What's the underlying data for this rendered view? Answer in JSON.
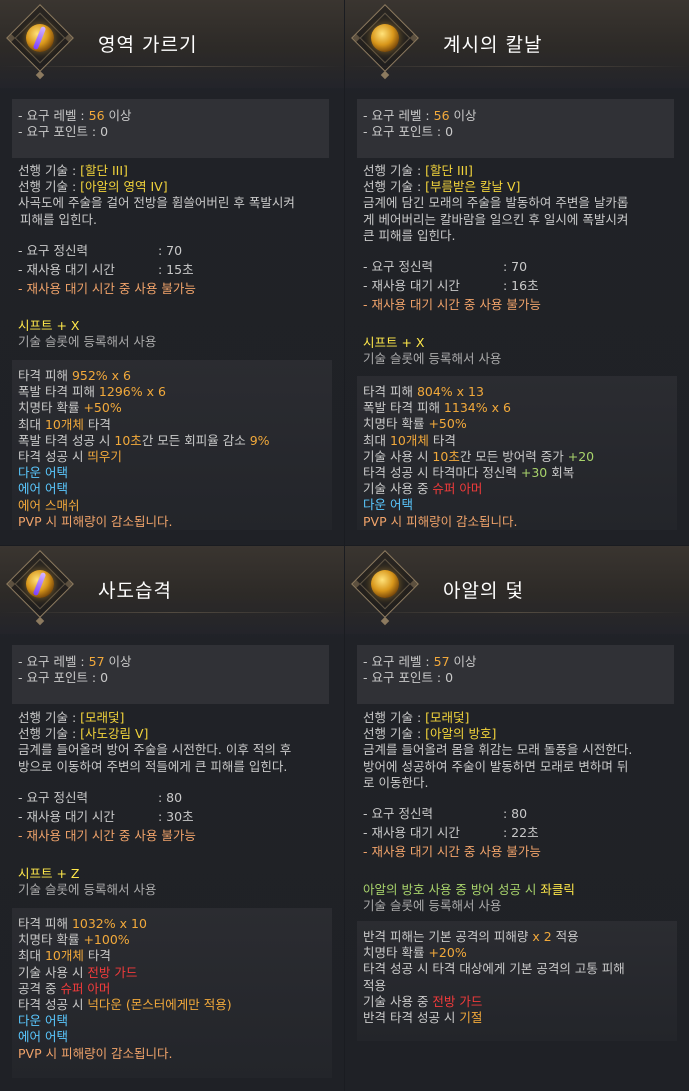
{
  "labels": {
    "req_level": "- 요구 레벨 : ",
    "req_level_suffix": " 이상",
    "req_point": "- 요구 포인트 : ",
    "prereq": "선행 기술 : ",
    "mp": "- 요구 정신력",
    "cooldown": "- 재사용 대기 시간",
    "cd_warning": "- 재사용 대기 시간 중 사용 불가능",
    "slot_register": "기술 슬롯에 등록해서 사용",
    "pvp_note": "PVP 시 피해량이 감소됩니다."
  },
  "cards": [
    {
      "title": "영역 가르기",
      "level": "56",
      "point": "0",
      "prereqs": [
        "[할단 III]",
        "[아알의 영역 IV]"
      ],
      "desc": [
        "사곡도에 주술을 걸어 전방을 휩쓸어버린 후 폭발시켜",
        "피해를 입힌다."
      ],
      "mp": ": 70",
      "cd": ": 15초",
      "hotkey": "시프트 + X",
      "stats": [
        {
          "t": "타격 피해 ",
          "v": "952% x 6"
        },
        {
          "t": "폭발 타격 피해 ",
          "v": "1296% x 6"
        },
        {
          "t": "치명타 확률 ",
          "v": "+50%"
        },
        {
          "t": "최대 ",
          "v": "10개체",
          "t2": " 타격"
        },
        {
          "t": "폭발 타격 성공 시 ",
          "v": "10초",
          "t2": "간 모든 회피율 감소 ",
          "v2": "9%"
        },
        {
          "t": "타격 성공 시 ",
          "v": "띄우기"
        }
      ],
      "links": [
        "다운 어택",
        "에어 어택"
      ],
      "extra": "에어 스매쉬"
    },
    {
      "title": "계시의 칼날",
      "level": "56",
      "point": "0",
      "prereqs": [
        "[할단 III]",
        "[부름받은 칼날 V]"
      ],
      "desc": [
        "금계에 담긴 모래의 주술을 발동하여 주변을 날카롭",
        "게 베어버리는 칼바람을 일으킨 후 일시에 폭발시켜",
        "큰 피해를 입힌다."
      ],
      "mp": ": 70",
      "cd": ": 16초",
      "hotkey": "시프트 + X",
      "stats": [
        {
          "t": "타격 피해 ",
          "v": "804% x 13"
        },
        {
          "t": "폭발 타격 피해 ",
          "v": "1134% x 6"
        },
        {
          "t": "치명타 확률 ",
          "v": "+50%"
        },
        {
          "t": "최대 ",
          "v": "10개체",
          "t2": " 타격"
        },
        {
          "t": "기술 사용 시 ",
          "v": "10초",
          "t2": "간 모든 방어력 증가 ",
          "v2": "+20"
        },
        {
          "t": "타격 성공 시 타격마다 정신력 ",
          "v": "+30",
          "t2": " 회복"
        },
        {
          "t": "기술 사용 중 ",
          "r": "슈퍼 아머"
        }
      ],
      "links": [
        "다운 어택"
      ]
    },
    {
      "title": "사도습격",
      "level": "57",
      "point": "0",
      "prereqs": [
        "[모래덫]",
        "[사도강림 V]"
      ],
      "desc": [
        "금계를 들어올려 방어 주술을 시전한다. 이후 적의 후",
        "방으로 이동하여 주변의 적들에게 큰 피해를 입힌다."
      ],
      "mp": ": 80",
      "cd": ": 30초",
      "hotkey": "시프트 + Z",
      "stats": [
        {
          "t": "타격 피해 ",
          "v": "1032% x 10"
        },
        {
          "t": "치명타 확률 ",
          "v": "+100%"
        },
        {
          "t": "최대 ",
          "v": "10개체",
          "t2": " 타격"
        },
        {
          "t": "기술 사용 시 ",
          "r": "전방 가드"
        },
        {
          "t": "공격 중 ",
          "r": "슈퍼 아머"
        },
        {
          "t": "타격 성공 시 ",
          "v": "넉다운 (몬스터에게만 적용)"
        }
      ],
      "links": [
        "다운 어택",
        "에어 어택"
      ]
    },
    {
      "title": "아알의 덫",
      "level": "57",
      "point": "0",
      "prereqs": [
        "[모래덫]",
        "[아알의 방호]"
      ],
      "desc": [
        "금계를 들어올려 몸을 휘감는 모래 돌풍을 시전한다.",
        "방어에 성공하여 주술이 발동하면 모래로 변하며 뒤",
        "로 이동한다."
      ],
      "mp": ": 80",
      "cd": ": 22초",
      "hotkey_text": "아알의 방호 사용 중 방어 성공 시 ",
      "hotkey_key": "좌클릭",
      "stats": [
        {
          "t": "반격 피해는 기본 공격의 피해량 ",
          "v": "x 2",
          "t2": " 적용"
        },
        {
          "t": "치명타 확률 ",
          "v": "+20%"
        },
        {
          "t": "타격 성공 시 타격 대상에게 기본 공격의 고통 피해"
        },
        {
          "t": "적용"
        },
        {
          "t": "기술 사용 중 ",
          "r": "전방 가드"
        },
        {
          "t": "반격 타격 성공 시 ",
          "v": "기절"
        }
      ]
    }
  ]
}
